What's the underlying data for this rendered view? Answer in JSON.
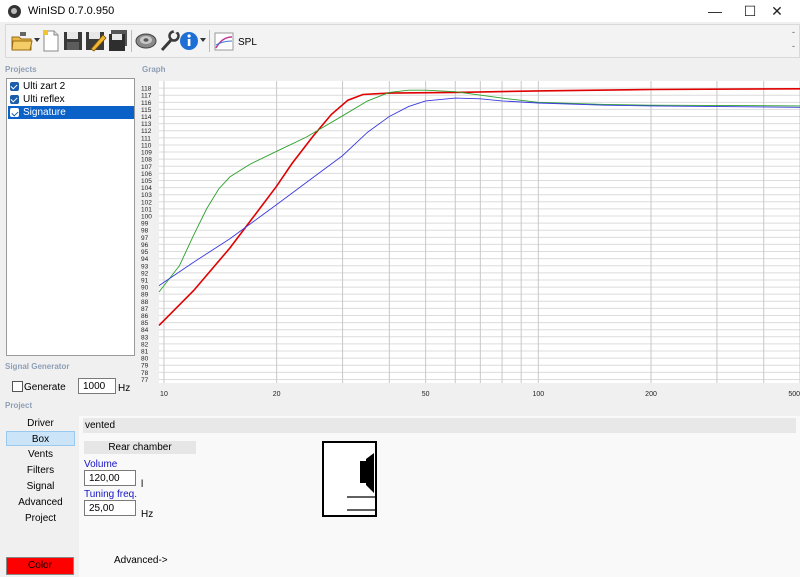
{
  "window": {
    "title": "WinISD 0.7.0.950",
    "minimize": "—",
    "maximize": "☐",
    "close": "✕"
  },
  "toolbar": {
    "spl_label": "SPL",
    "dash": "-"
  },
  "sections": {
    "projects": "Projects",
    "graph": "Graph",
    "signal_generator": "Signal Generator",
    "project": "Project"
  },
  "projects": [
    {
      "name": "Ulti zart 2",
      "checked": true,
      "selected": false
    },
    {
      "name": "Ulti reflex",
      "checked": true,
      "selected": false
    },
    {
      "name": "Signature",
      "checked": true,
      "selected": true
    }
  ],
  "signal_generator": {
    "generate_label": "Generate",
    "generate_checked": false,
    "frequency": "1000",
    "unit": "Hz"
  },
  "nav": [
    "Driver",
    "Box",
    "Vents",
    "Filters",
    "Signal",
    "Advanced",
    "Project"
  ],
  "nav_active": "Box",
  "color_button": "Color",
  "color_value": "#ff0000",
  "box": {
    "type": "vented",
    "rear_chamber": "Rear chamber",
    "volume_label": "Volume",
    "volume_value": "120,00",
    "volume_unit": "l",
    "tuning_label": "Tuning freq.",
    "tuning_value": "25,00",
    "tuning_unit": "Hz",
    "advanced_link": "Advanced->"
  },
  "chart_data": {
    "type": "line",
    "title": "",
    "xlabel": "",
    "ylabel": "",
    "xscale": "log",
    "xlim": [
      9.7,
      500
    ],
    "ylim": [
      76.5,
      119
    ],
    "x_ticks": [
      "10",
      "20",
      "50",
      "100",
      "200",
      "500"
    ],
    "y_ticks": [
      "77",
      "78",
      "79",
      "80",
      "81",
      "82",
      "83",
      "84",
      "85",
      "86",
      "87",
      "88",
      "89",
      "90",
      "91",
      "92",
      "93",
      "94",
      "95",
      "96",
      "97",
      "98",
      "99",
      "100",
      "101",
      "102",
      "103",
      "104",
      "105",
      "106",
      "107",
      "108",
      "109",
      "110",
      "111",
      "112",
      "113",
      "114",
      "115",
      "116",
      "117",
      "118"
    ],
    "grid": true,
    "series": [
      {
        "color": "#e00000",
        "points": [
          [
            9.7,
            84.6
          ],
          [
            12,
            89.5
          ],
          [
            15,
            95.5
          ],
          [
            18,
            101
          ],
          [
            20,
            104.2
          ],
          [
            22,
            107.4
          ],
          [
            25,
            111.2
          ],
          [
            28,
            114.3
          ],
          [
            31,
            116.3
          ],
          [
            34,
            117.1
          ],
          [
            40,
            117.3
          ],
          [
            60,
            117.4
          ],
          [
            100,
            117.6
          ],
          [
            200,
            117.8
          ],
          [
            500,
            117.9
          ]
        ]
      },
      {
        "color": "#2aa02a",
        "points": [
          [
            9.7,
            89.3
          ],
          [
            11,
            93
          ],
          [
            12,
            97.3
          ],
          [
            13,
            101
          ],
          [
            14,
            103.8
          ],
          [
            15,
            105.5
          ],
          [
            17,
            107.3
          ],
          [
            20,
            109.1
          ],
          [
            24,
            111.1
          ],
          [
            30,
            114.1
          ],
          [
            35,
            116.2
          ],
          [
            40,
            117.4
          ],
          [
            45,
            117.7
          ],
          [
            50,
            117.7
          ],
          [
            60,
            117.5
          ],
          [
            80,
            116.6
          ],
          [
            100,
            116.0
          ],
          [
            150,
            115.7
          ],
          [
            200,
            115.6
          ],
          [
            500,
            115.5
          ]
        ]
      },
      {
        "color": "#3a3ae0",
        "points": [
          [
            9.7,
            90.2
          ],
          [
            12,
            93.5
          ],
          [
            15,
            96.8
          ],
          [
            20,
            101.6
          ],
          [
            25,
            105.4
          ],
          [
            30,
            108.5
          ],
          [
            35,
            111.8
          ],
          [
            40,
            114.0
          ],
          [
            45,
            115.4
          ],
          [
            50,
            116.2
          ],
          [
            60,
            116.6
          ],
          [
            70,
            116.5
          ],
          [
            80,
            116.2
          ],
          [
            100,
            115.9
          ],
          [
            150,
            115.6
          ],
          [
            200,
            115.5
          ],
          [
            500,
            115.3
          ]
        ]
      }
    ]
  }
}
